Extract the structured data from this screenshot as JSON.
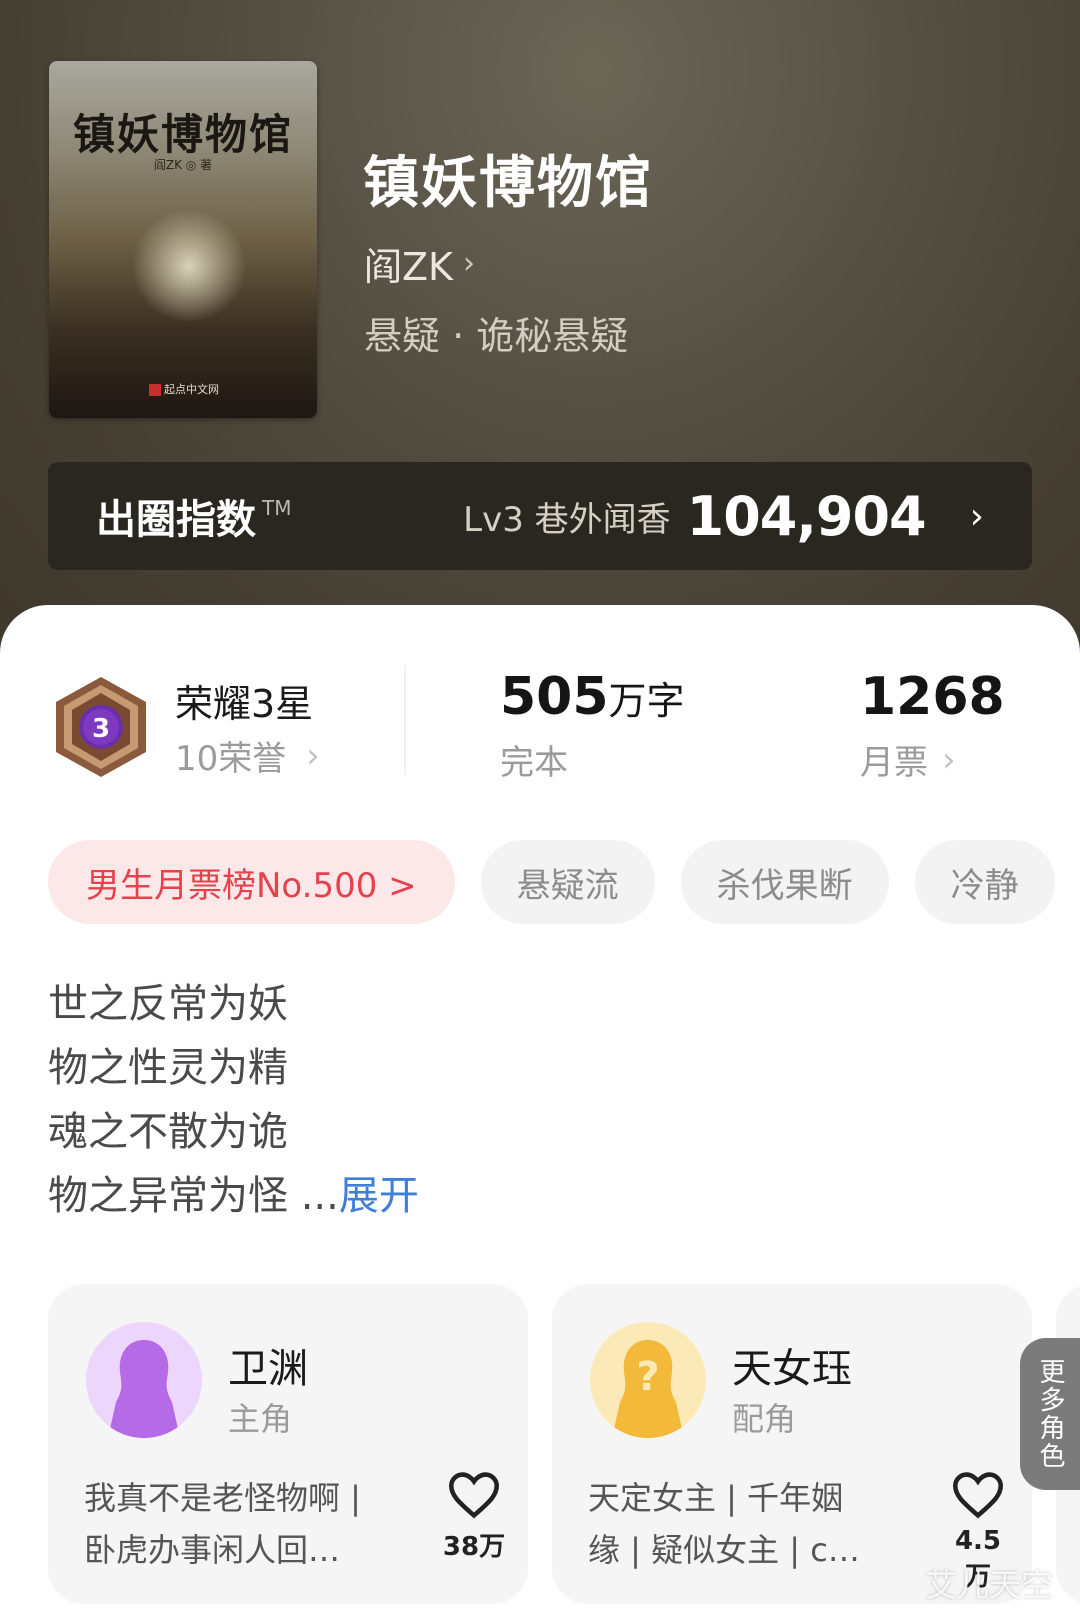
{
  "book": {
    "cover_title": "镇妖博物馆",
    "cover_author": "阎ZK ◎ 著",
    "cover_publisher": "起点中文网",
    "title": "镇妖博物馆",
    "author": "阎ZK",
    "genre": "悬疑 · 诡秘悬疑"
  },
  "index": {
    "label": "出圈指数",
    "tm": "TM",
    "level": "Lv3 巷外闻香",
    "score": "104,904"
  },
  "stats": {
    "honor_title": "荣耀3星",
    "honor_sub": "10荣誉",
    "badge_level": "3",
    "words_value": "505",
    "words_unit": "万字",
    "words_sub": "完本",
    "tickets_value": "1268",
    "tickets_sub": "月票"
  },
  "tags": [
    "男生月票榜No.500 >",
    "悬疑流",
    "杀伐果断",
    "冷静"
  ],
  "intro": {
    "lines": [
      "世之反常为妖",
      "物之性灵为精",
      "魂之不散为诡",
      "物之异常为怪"
    ],
    "ellipsis": " ...",
    "expand": "展开"
  },
  "characters": [
    {
      "name": "卫渊",
      "role": "主角",
      "desc_line1": "我真不是老怪物啊 |",
      "desc_line2": "卧虎办事闲人回…",
      "likes": "38万",
      "avatar_color": "#b56be8"
    },
    {
      "name": "天女珏",
      "role": "配角",
      "desc_line1": "天定女主 | 千年姻",
      "desc_line2": "缘 | 疑似女主 | c…",
      "likes": "4.5万",
      "avatar_color": "#f2b93b"
    }
  ],
  "more_roles": "更多角色",
  "watermark": "艾儿天空",
  "colors": {
    "accent_red": "#e5424d",
    "link_blue": "#3e7fd8"
  }
}
